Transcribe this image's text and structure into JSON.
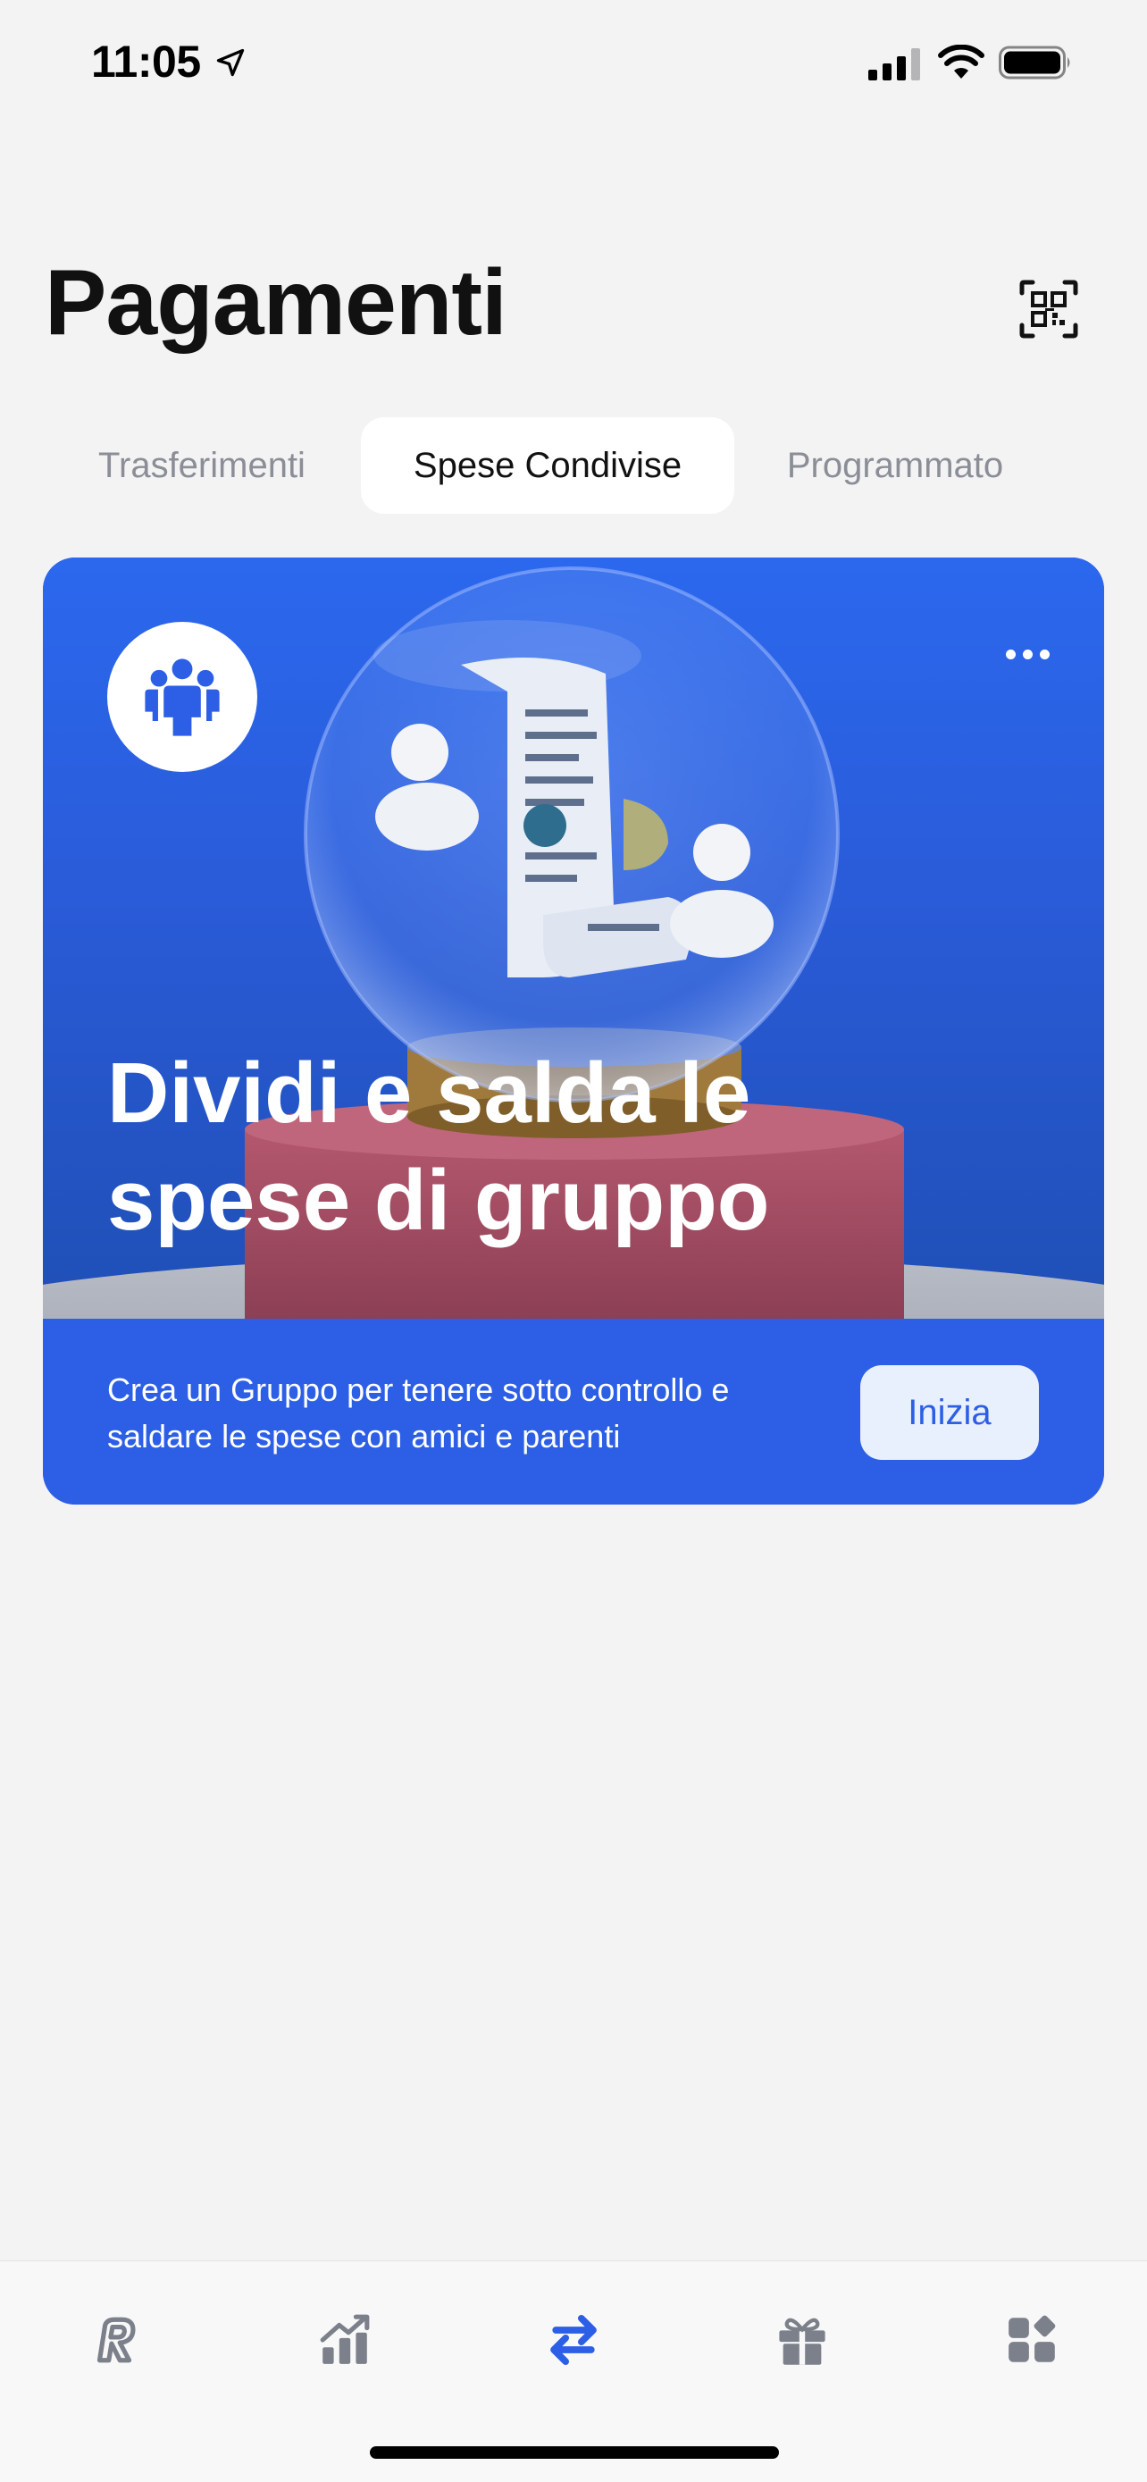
{
  "status_bar": {
    "time": "11:05",
    "icons": [
      "location-arrow-icon",
      "signal-bars-icon",
      "wifi-icon",
      "battery-icon"
    ]
  },
  "header": {
    "title": "Pagamenti",
    "qr_icon": "qr-code-scan-icon"
  },
  "tabs": [
    {
      "label": "Trasferimenti",
      "active": false
    },
    {
      "label": "Spese Condivise",
      "active": true
    },
    {
      "label": "Programmato",
      "active": false
    }
  ],
  "card": {
    "avatar_icon": "group-people-icon",
    "more_icon": "more-dots-icon",
    "title": "Dividi e salda le spese di gruppo",
    "description": "Crea un Gruppo per tenere sotto controllo e saldare le spese con amici e parenti",
    "button_label": "Inizia"
  },
  "bottom_nav": {
    "items": [
      {
        "icon": "revolut-home-icon",
        "active": false
      },
      {
        "icon": "stocks-chart-icon",
        "active": false
      },
      {
        "icon": "transfer-arrows-icon",
        "active": true
      },
      {
        "icon": "gift-icon",
        "active": false
      },
      {
        "icon": "hub-grid-icon",
        "active": false
      }
    ]
  },
  "colors": {
    "brand_blue": "#2c5fe6",
    "background": "#f3f3f4",
    "inactive_text": "#8b8e96",
    "inactive_icon": "#7c808a"
  }
}
